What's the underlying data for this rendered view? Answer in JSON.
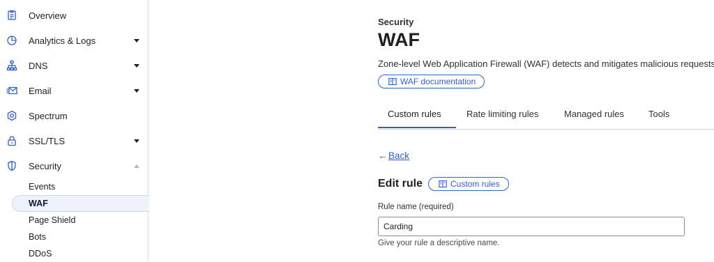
{
  "sidebar": {
    "items": [
      {
        "label": "Overview",
        "icon": "overview-icon"
      },
      {
        "label": "Analytics & Logs",
        "icon": "analytics-icon",
        "caret": "down"
      },
      {
        "label": "DNS",
        "icon": "dns-icon",
        "caret": "down"
      },
      {
        "label": "Email",
        "icon": "email-icon",
        "caret": "down"
      },
      {
        "label": "Spectrum",
        "icon": "spectrum-icon"
      },
      {
        "label": "SSL/TLS",
        "icon": "lock-icon",
        "caret": "down"
      },
      {
        "label": "Security",
        "icon": "shield-icon",
        "caret": "up"
      }
    ],
    "security_sub": [
      {
        "label": "Events"
      },
      {
        "label": "WAF",
        "active": true
      },
      {
        "label": "Page Shield"
      },
      {
        "label": "Bots"
      },
      {
        "label": "DDoS"
      }
    ]
  },
  "header": {
    "breadcrumb": "Security",
    "title": "WAF",
    "description": "Zone-level Web Application Firewall (WAF) detects and mitigates malicious requests",
    "doc_link": "WAF documentation"
  },
  "tabs": [
    {
      "label": "Custom rules",
      "active": true
    },
    {
      "label": "Rate limiting rules"
    },
    {
      "label": "Managed rules"
    },
    {
      "label": "Tools"
    }
  ],
  "back_label": "Back",
  "edit": {
    "title": "Edit rule",
    "badge": "Custom rules",
    "rule_name_label": "Rule name (required)",
    "rule_name_value": "Carding",
    "rule_name_help": "Give your rule a descriptive name."
  },
  "colors": {
    "accent": "#2c5fd0",
    "active_bg": "#eef3fb"
  }
}
